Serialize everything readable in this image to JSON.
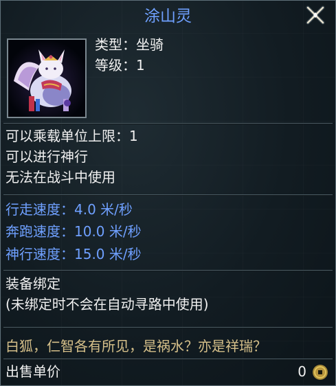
{
  "item": {
    "name": "涂山灵",
    "type_line": "类型：坐骑",
    "level_line": "等级：1",
    "portrait_icon": "white-fox-mount-icon"
  },
  "attributes": [
    "可以乘载单位上限：1",
    "可以进行神行",
    "无法在战斗中使用"
  ],
  "speeds": [
    "行走速度：4.0 米/秒",
    "奔跑速度：10.0 米/秒",
    "神行速度：15.0 米/秒"
  ],
  "binding": {
    "line1": "装备绑定",
    "line2": "(未绑定时不会在自动寻路中使用)"
  },
  "flavor_text": "白狐，仁智各有所见，是祸水？亦是祥瑞？",
  "sell": {
    "label": "出售单价",
    "value": "0",
    "currency_icon": "copper-coin-icon"
  },
  "colors": {
    "title_blue": "#6fa0ff",
    "flavor_gold": "#d6c08a",
    "text_white": "#f0f0f0"
  },
  "close_icon": "close-icon"
}
